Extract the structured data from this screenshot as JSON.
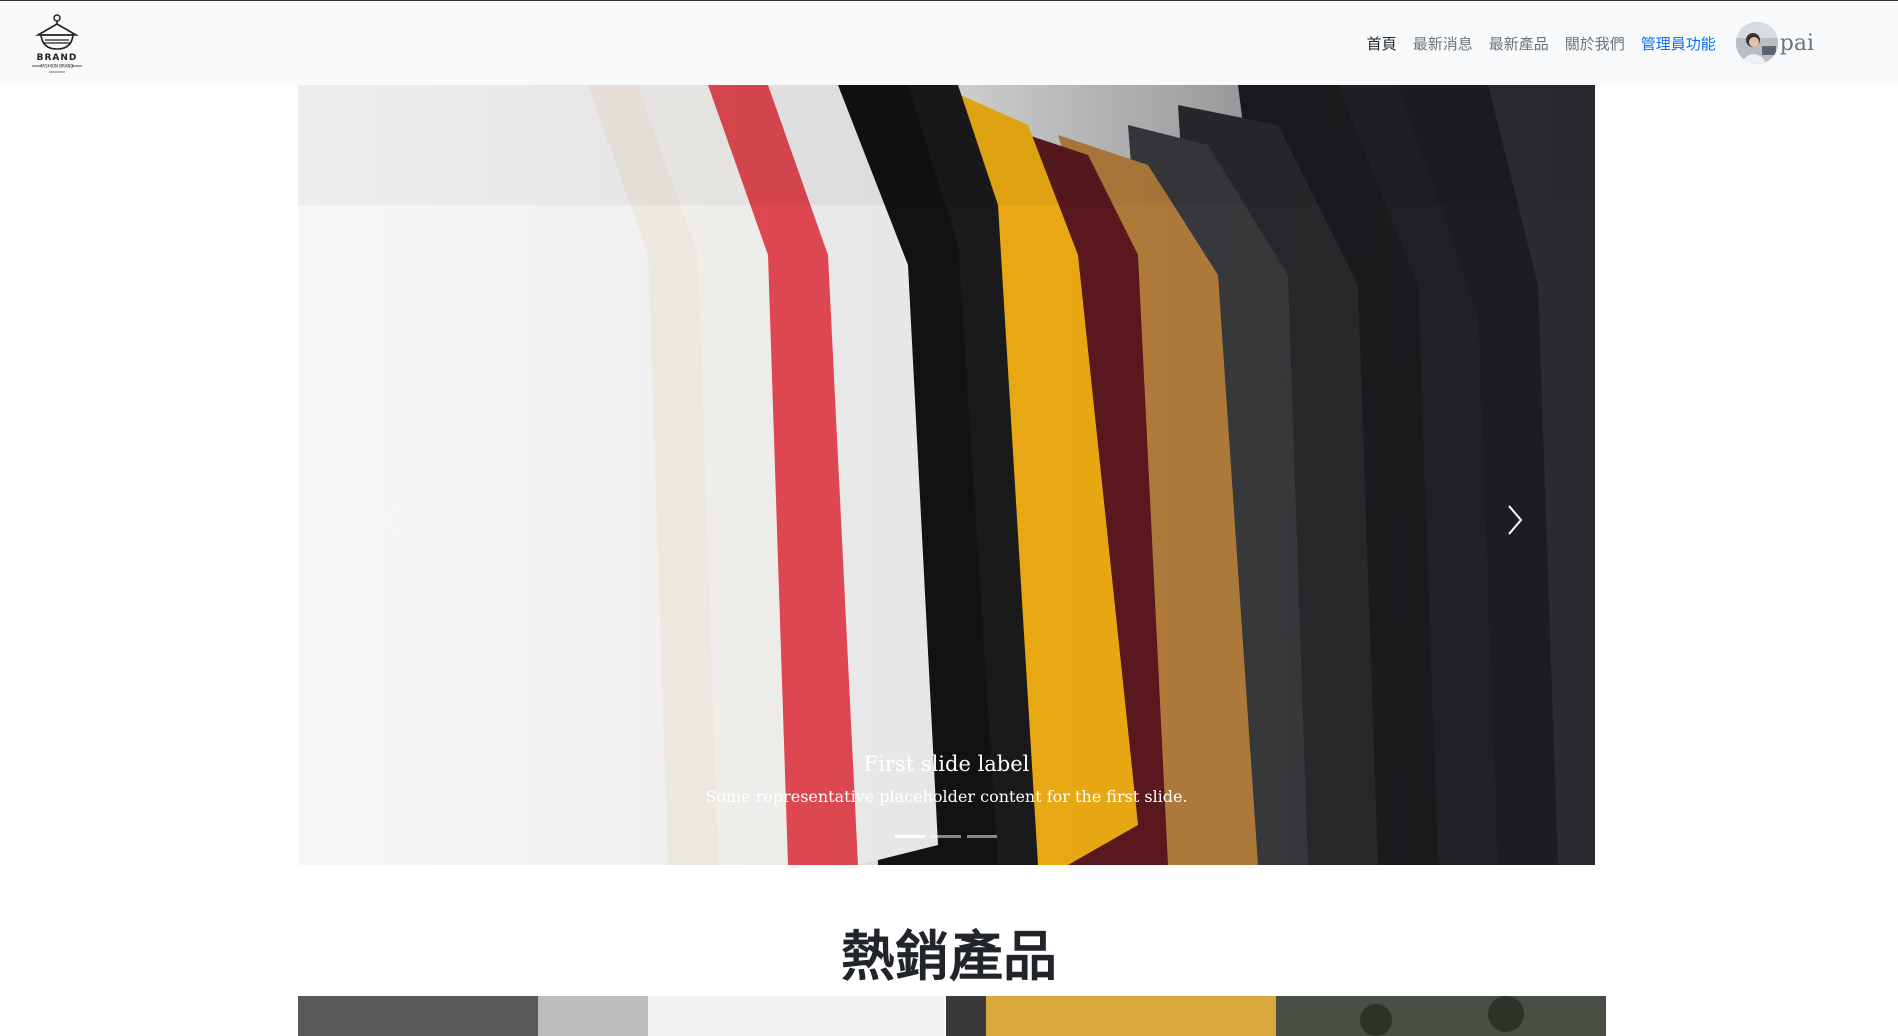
{
  "brand": {
    "logo_text": "BRAND",
    "logo_subtext": "FASHION BRAND"
  },
  "nav": {
    "items": [
      {
        "label": "首頁",
        "state": "active"
      },
      {
        "label": "最新消息",
        "state": "normal"
      },
      {
        "label": "最新產品",
        "state": "normal"
      },
      {
        "label": "關於我們",
        "state": "normal"
      },
      {
        "label": "管理員功能",
        "state": "admin"
      }
    ],
    "user": {
      "name": "pai"
    }
  },
  "carousel": {
    "slide_count": 3,
    "active_index": 0,
    "caption": {
      "title": "First slide label",
      "text": "Some representative placeholder content for the first slide."
    },
    "controls": {
      "prev": "chevron-left-icon",
      "next": "chevron-right-icon"
    }
  },
  "main": {
    "section_title": "熱銷產品"
  },
  "colors": {
    "navbar_bg": "#f8f9fa",
    "nav_text": "#6c757d",
    "nav_active": "#212529",
    "nav_admin": "#0d6efd"
  }
}
